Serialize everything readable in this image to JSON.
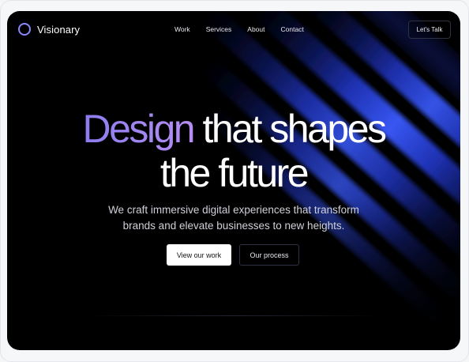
{
  "nav": {
    "brand": "Visionary",
    "links": [
      {
        "label": "Work"
      },
      {
        "label": "Services"
      },
      {
        "label": "About"
      },
      {
        "label": "Contact"
      }
    ],
    "cta_label": "Let's Talk"
  },
  "hero": {
    "headline_accent": "Design",
    "headline_rest_line1": " that shapes",
    "headline_line2": "the future",
    "subtext_line1": "We craft immersive digital experiences that transform",
    "subtext_line2": "brands and elevate businesses to new heights.",
    "primary_button": "View our work",
    "secondary_button": "Our process"
  },
  "colors": {
    "background": "#000000",
    "accent_gradient_start": "#8c7cf0",
    "accent_gradient_end": "#b58ef2",
    "beam_blue": "#2a45d8"
  }
}
